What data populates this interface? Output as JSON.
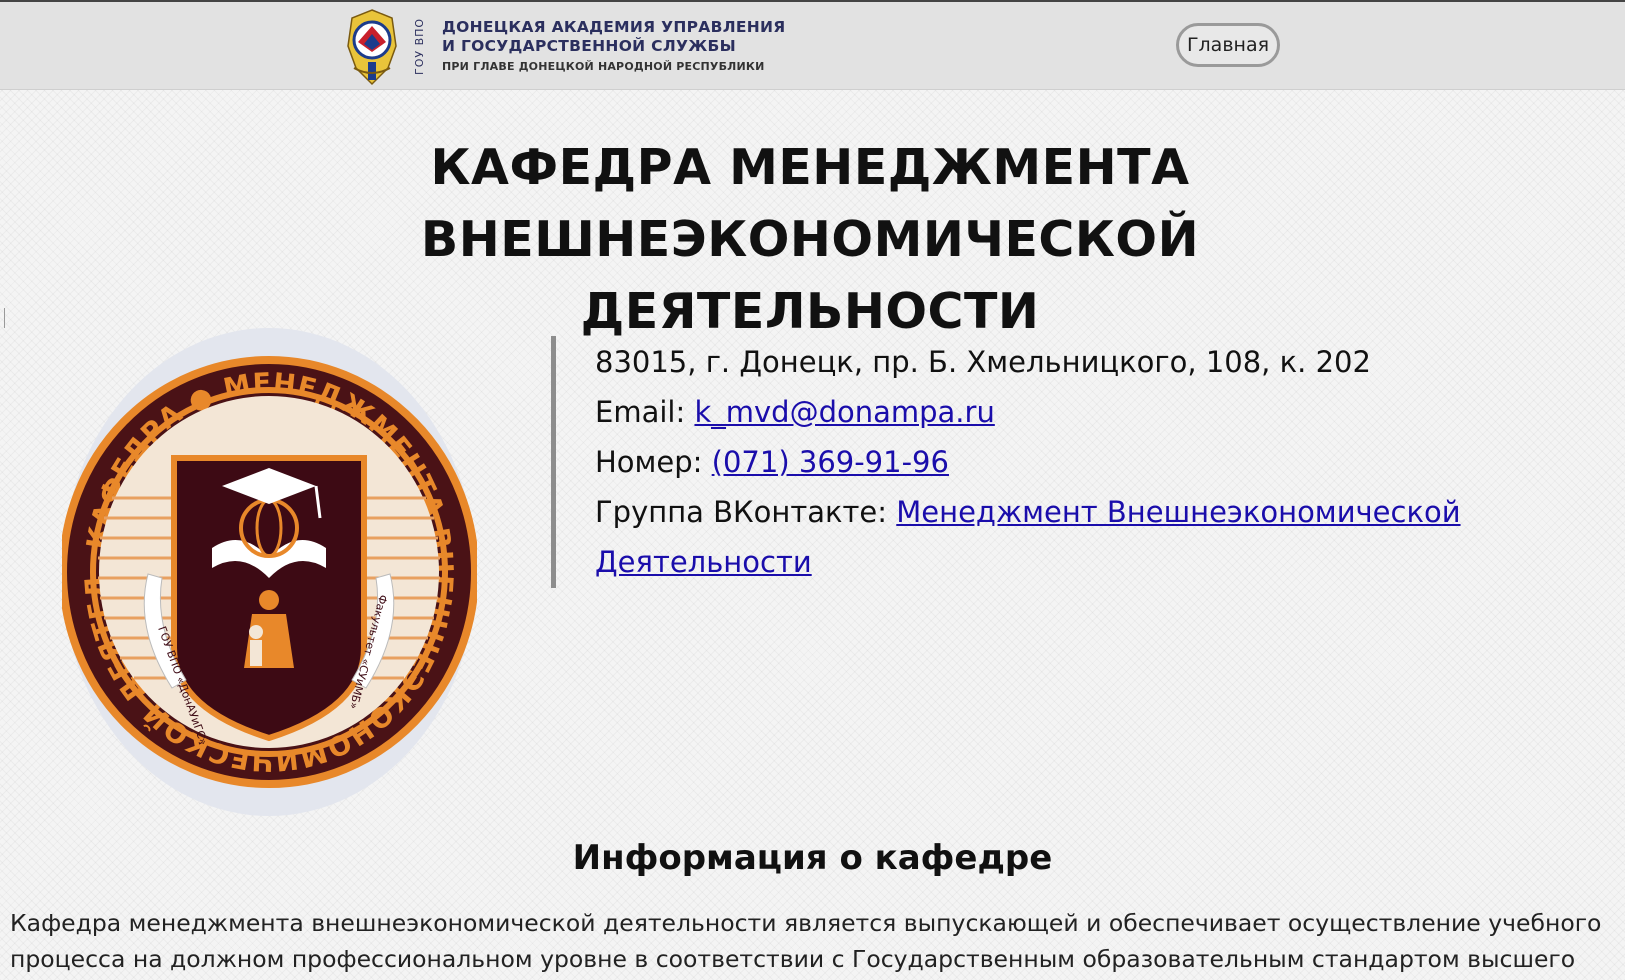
{
  "header": {
    "academy_vertical": "ГОУ ВПО",
    "academy_line1": "ДОНЕЦКАЯ АКАДЕМИЯ УПРАВЛЕНИЯ",
    "academy_line2": "И ГОСУДАРСТВЕННОЙ СЛУЖБЫ",
    "academy_line3": "ПРИ ГЛАВЕ ДОНЕЦКОЙ НАРОДНОЙ РЕСПУБЛИКИ",
    "nav_home": "Главная"
  },
  "page": {
    "title_line1": "КАФЕДРА МЕНЕДЖМЕНТА ВНЕШНЕЭКОНОМИЧЕСКОЙ",
    "title_line2": "ДЕЯТЕЛЬНОСТИ"
  },
  "dept_logo": {
    "ring_text": "КАФЕДРА ● МЕНЕДЖМЕНТА ВНЕШНЕЭКОНОМИЧЕСКОЙ ДЕЯТЕЛЬНОСТИ ●",
    "ribbon_left": "ГОУ ВПО «ДонАУиГС»",
    "ribbon_right": "Факультет «СУиМБ»",
    "colors": {
      "ring": "#4a1216",
      "accent": "#e8882a",
      "shield": "#3d0a14"
    }
  },
  "contacts": {
    "address": "83015, г. Донецк, пр. Б. Хмельницкого, 108, к. 202",
    "email_label": "Email: ",
    "email_value": "k_mvd@donampa.ru",
    "phone_label": "Номер: ",
    "phone_value": "(071) 369-91-96",
    "vk_label": "Группа ВКонтакте: ",
    "vk_value_line1": "Менеджмент Внешнеэкономической",
    "vk_value_line2": "Деятельности"
  },
  "about": {
    "heading": "Информация о кафедре",
    "text": "Кафедра менеджмента внешнеэкономической деятельности является выпускающей и обеспечивает осуществление учебного процесса на должном профессиональном уровне в соответствии с Государственным образовательным стандартом высшего"
  }
}
